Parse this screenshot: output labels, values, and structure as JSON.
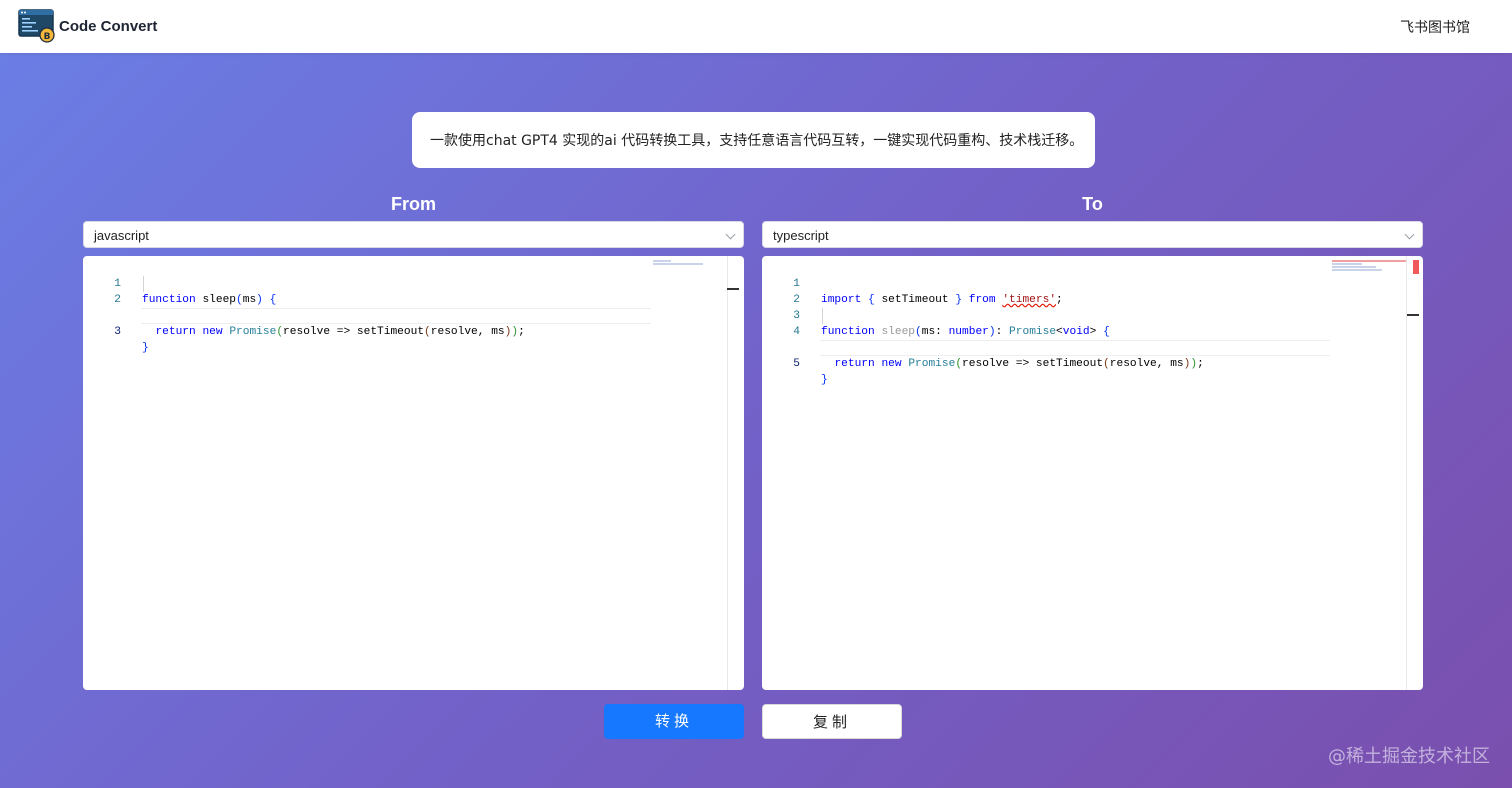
{
  "header": {
    "brand": "Code Convert",
    "nav_link": "飞书图书馆",
    "logo_icon": "code-window-bitcoin-icon",
    "logo_badge": "B"
  },
  "description": "一款使用chat GPT4 实现的ai 代码转换工具，支持任意语言代码互转，一键实现代码重构、技术栈迁移。",
  "from_panel": {
    "title": "From",
    "language": "javascript",
    "line_numbers": [
      "1",
      "2",
      "3"
    ],
    "code_lines": [
      "function sleep(ms) {",
      "  return new Promise(resolve => setTimeout(resolve, ms));",
      "}"
    ]
  },
  "to_panel": {
    "title": "To",
    "language": "typescript",
    "line_numbers": [
      "1",
      "2",
      "3",
      "4",
      "5"
    ],
    "code_lines": [
      "import { setTimeout } from 'timers';",
      "",
      "function sleep(ms: number): Promise<void> {",
      "  return new Promise(resolve => setTimeout(resolve, ms));",
      "}"
    ]
  },
  "buttons": {
    "convert": "转换",
    "copy": "复制"
  },
  "watermark": "@稀土掘金技术社区",
  "colors": {
    "primary": "#1677ff",
    "keyword": "#0000ff",
    "type": "#267f99",
    "string": "#a31515",
    "line_number": "#237893"
  }
}
